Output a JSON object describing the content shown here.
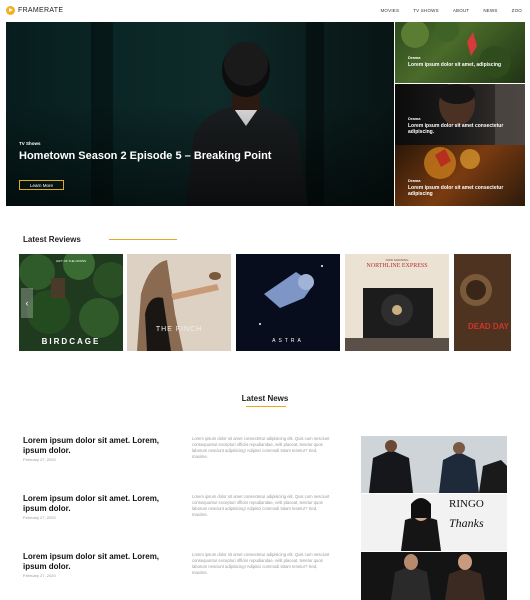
{
  "brand": {
    "name": "FRAMERATE",
    "accent": "#e3a91f"
  },
  "nav": {
    "items": [
      "MOVIES",
      "TV SHOWS",
      "ABOUT",
      "NEWS",
      "ZOO"
    ]
  },
  "hero": {
    "tag": "TV Shows",
    "title": "Hometown Season 2 Episode 5 – Breaking Point",
    "button": "Learn More"
  },
  "sidebar": {
    "items": [
      {
        "tag": "Drama",
        "text": "Lorem ipsum dolor sit amet, adipiscing"
      },
      {
        "tag": "Drama",
        "text": "Lorem ipsum dolor sit amet consectetur adipiscing."
      },
      {
        "tag": "Drama",
        "text": "Lorem ipsum dolor sit amet consectetur adipiscing"
      }
    ]
  },
  "reviews": {
    "heading": "Latest Reviews",
    "posters": [
      {
        "title": "BIRDCAGE",
        "top_caption": "GIFT OF THE CROSS"
      },
      {
        "title": "THE FINCH"
      },
      {
        "title": "ASTRA"
      },
      {
        "title": "NORTHLINE EXPRESS",
        "top_caption": "NOW SHOWING"
      },
      {
        "title": "DEAD DAY"
      }
    ]
  },
  "news": {
    "heading": "Latest News",
    "items": [
      {
        "title": "Lorem ipsum dolor sit amet. Lorem, ipsum dolor.",
        "date": "February 27, 2020",
        "excerpt": "Lorem ipsum dolor sit amet consectetur adipisicing elit. Quis cum nesciunt consequuntur excepturi officiis repudiandae, velit placeat, tenetur quos laborum nesciunt adipisicing! Adipisci commodi totam tenetur? Sed, maxime."
      },
      {
        "title": "Lorem ipsum dolor sit amet. Lorem, ipsum dolor.",
        "date": "February 27, 2020",
        "excerpt": "Lorem ipsum dolor sit amet consectetur adipisicing elit. Quis cum nesciunt consequuntur excepturi officiis repudiandae, velit placeat, tenetur quos laborum nesciunt adipisicing! Adipisci commodi totam tenetur? Sed, maxime."
      },
      {
        "title": "Lorem ipsum dolor sit amet. Lorem, ipsum dolor.",
        "date": "February 27, 2020",
        "excerpt": "Lorem ipsum dolor sit amet consectetur adipisicing elit. Quis cum nesciunt consequuntur excepturi officiis repudiandae, velit placeat, tenetur quos laborum nesciunt adipisicing! Adipisci commodi totam tenetur? Sed, maxime."
      }
    ],
    "image_texts": [
      "RINGO",
      "Thanks"
    ]
  }
}
